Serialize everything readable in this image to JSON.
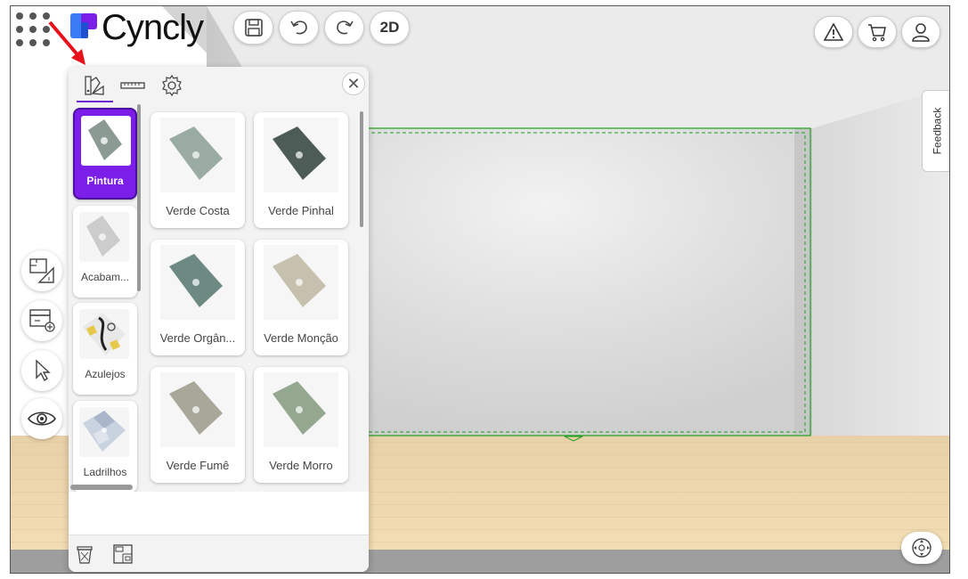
{
  "app": {
    "brand": "Cyncly"
  },
  "toolbar": {
    "view_mode_label": "2D"
  },
  "panel": {
    "tabs": [
      {
        "icon": "paint-swatches-icon"
      },
      {
        "icon": "ruler-icon"
      },
      {
        "icon": "gear-icon"
      }
    ],
    "categories": [
      {
        "label": "Pintura",
        "active": true
      },
      {
        "label": "Acabam...",
        "active": false
      },
      {
        "label": "Azulejos",
        "active": false
      },
      {
        "label": "Ladrilhos",
        "active": false
      }
    ],
    "swatches": [
      {
        "label": "Verde Costa",
        "color": "#9aaca2"
      },
      {
        "label": "Verde Pinhal",
        "color": "#4e5c57"
      },
      {
        "label": "Verde Orgân...",
        "color": "#6d8a82"
      },
      {
        "label": "Verde Monção",
        "color": "#c5c1ae"
      },
      {
        "label": "Verde Fumê",
        "color": "#a9a79a"
      },
      {
        "label": "Verde Morro",
        "color": "#93a88e"
      }
    ],
    "footer_icons": [
      "trash-icon",
      "floorplan-icon"
    ]
  },
  "side_tools": [
    "floorplan-measure-icon",
    "add-furniture-icon",
    "pointer-icon",
    "eye-icon"
  ],
  "right_buttons": [
    "warning-icon",
    "cart-icon",
    "user-icon"
  ],
  "feedback_label": "Feedback",
  "colors": {
    "accent": "#7b1ee8",
    "selection_green": "#1ea01e",
    "annotation_arrow": "#e8101a"
  }
}
